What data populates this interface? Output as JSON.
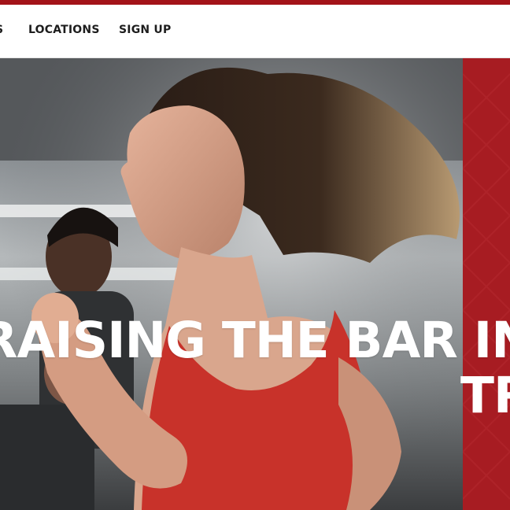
{
  "nav": {
    "cut_item_label": "S",
    "locations_label": "LOCATIONS",
    "signup_label": "SIGN UP"
  },
  "hero": {
    "headline_line1": "RAISING THE BAR IN PE",
    "headline_line2": "TR",
    "photo_icon": "runners-on-treadmills-photo"
  },
  "colors": {
    "brand_red": "#a31319",
    "panel_red": "#a71c22",
    "nav_text": "#1d1d1d",
    "headline_text": "#ffffff"
  }
}
